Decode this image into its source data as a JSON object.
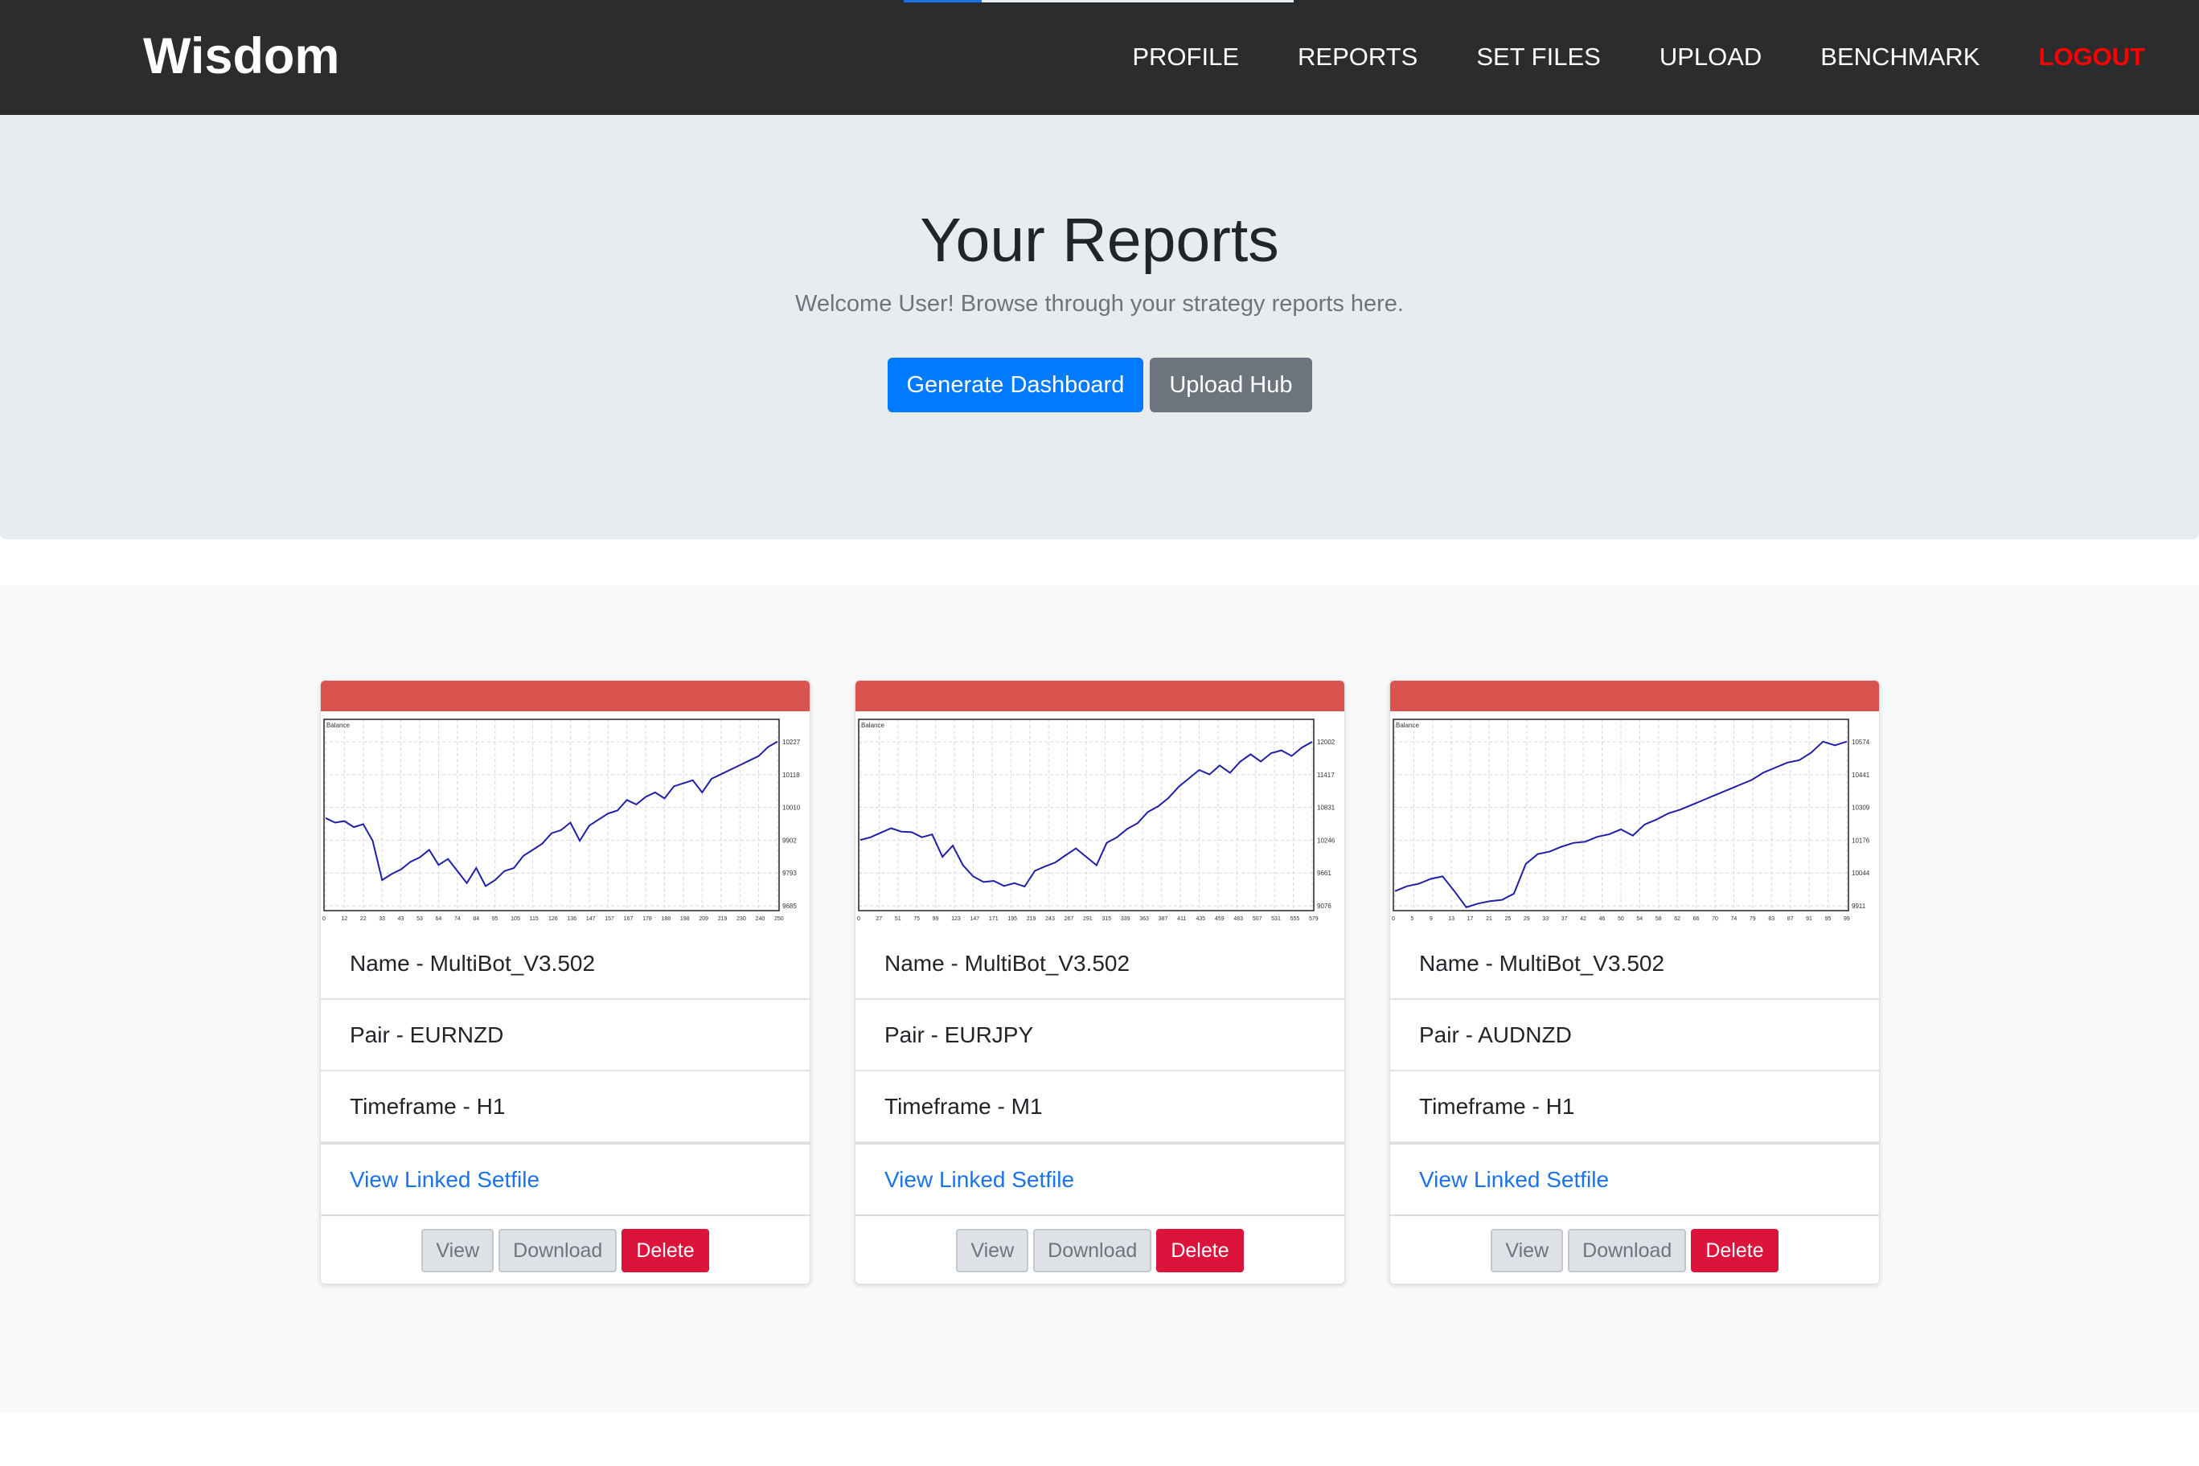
{
  "navbar": {
    "brand": "Wisdom",
    "links": [
      "PROFILE",
      "REPORTS",
      "SET FILES",
      "UPLOAD",
      "BENCHMARK"
    ],
    "logout": "LOGOUT",
    "progress_fraction": 0.2
  },
  "hero": {
    "title": "Your Reports",
    "subtitle": "Welcome User! Browse through your strategy reports here.",
    "generate_label": "Generate Dashboard",
    "upload_label": "Upload Hub"
  },
  "cards": [
    {
      "name": "Name - MultiBot_V3.502",
      "pair": "Pair - EURNZD",
      "timeframe": "Timeframe - H1",
      "link": "View Linked Setfile",
      "view": "View",
      "download": "Download",
      "delete": "Delete",
      "chart": {
        "legend": "Balance",
        "yticks": [
          "10227",
          "10118",
          "10010",
          "9902",
          "9793",
          "9685"
        ],
        "xticks": [
          "0",
          "12",
          "22",
          "33",
          "43",
          "53",
          "64",
          "74",
          "84",
          "95",
          "105",
          "115",
          "126",
          "136",
          "147",
          "157",
          "167",
          "178",
          "188",
          "198",
          "209",
          "219",
          "230",
          "240",
          "250"
        ],
        "series": [
          9975,
          9960,
          9965,
          9945,
          9955,
          9900,
          9770,
          9790,
          9805,
          9830,
          9845,
          9870,
          9820,
          9840,
          9800,
          9760,
          9810,
          9750,
          9770,
          9800,
          9810,
          9850,
          9870,
          9890,
          9925,
          9935,
          9960,
          9900,
          9950,
          9970,
          9990,
          10000,
          10035,
          10020,
          10045,
          10060,
          10040,
          10080,
          10090,
          10100,
          10060,
          10105,
          10120,
          10135,
          10150,
          10165,
          10180,
          10210,
          10228
        ]
      }
    },
    {
      "name": "Name - MultiBot_V3.502",
      "pair": "Pair - EURJPY",
      "timeframe": "Timeframe - M1",
      "link": "View Linked Setfile",
      "view": "View",
      "download": "Download",
      "delete": "Delete",
      "chart": {
        "legend": "Balance",
        "yticks": [
          "12002",
          "11417",
          "10831",
          "10246",
          "9661",
          "9076"
        ],
        "xticks": [
          "0",
          "27",
          "51",
          "75",
          "99",
          "123",
          "147",
          "171",
          "195",
          "219",
          "243",
          "267",
          "291",
          "315",
          "339",
          "363",
          "387",
          "411",
          "435",
          "459",
          "483",
          "507",
          "531",
          "555",
          "579"
        ],
        "series": [
          10250,
          10300,
          10380,
          10460,
          10400,
          10390,
          10300,
          10350,
          9950,
          10150,
          9800,
          9600,
          9500,
          9520,
          9430,
          9480,
          9420,
          9700,
          9780,
          9850,
          9980,
          10100,
          9950,
          9800,
          10200,
          10300,
          10450,
          10550,
          10750,
          10850,
          11000,
          11200,
          11350,
          11500,
          11420,
          11580,
          11450,
          11650,
          11780,
          11650,
          11800,
          11850,
          11750,
          11900,
          12002
        ]
      }
    },
    {
      "name": "Name - MultiBot_V3.502",
      "pair": "Pair - AUDNZD",
      "timeframe": "Timeframe - H1",
      "link": "View Linked Setfile",
      "view": "View",
      "download": "Download",
      "delete": "Delete",
      "chart": {
        "legend": "Balance",
        "yticks": [
          "10574",
          "10441",
          "10309",
          "10176",
          "10044",
          "9911"
        ],
        "xticks": [
          "0",
          "5",
          "9",
          "13",
          "17",
          "21",
          "25",
          "29",
          "33",
          "37",
          "42",
          "46",
          "50",
          "54",
          "58",
          "62",
          "66",
          "70",
          "74",
          "79",
          "83",
          "87",
          "91",
          "95",
          "99"
        ],
        "series": [
          9970,
          9990,
          10000,
          10020,
          10030,
          9970,
          9905,
          9920,
          9930,
          9935,
          9960,
          10080,
          10120,
          10130,
          10150,
          10165,
          10170,
          10190,
          10200,
          10220,
          10195,
          10240,
          10260,
          10285,
          10300,
          10320,
          10340,
          10360,
          10380,
          10400,
          10420,
          10450,
          10470,
          10490,
          10500,
          10530,
          10575,
          10560,
          10575
        ]
      }
    }
  ]
}
